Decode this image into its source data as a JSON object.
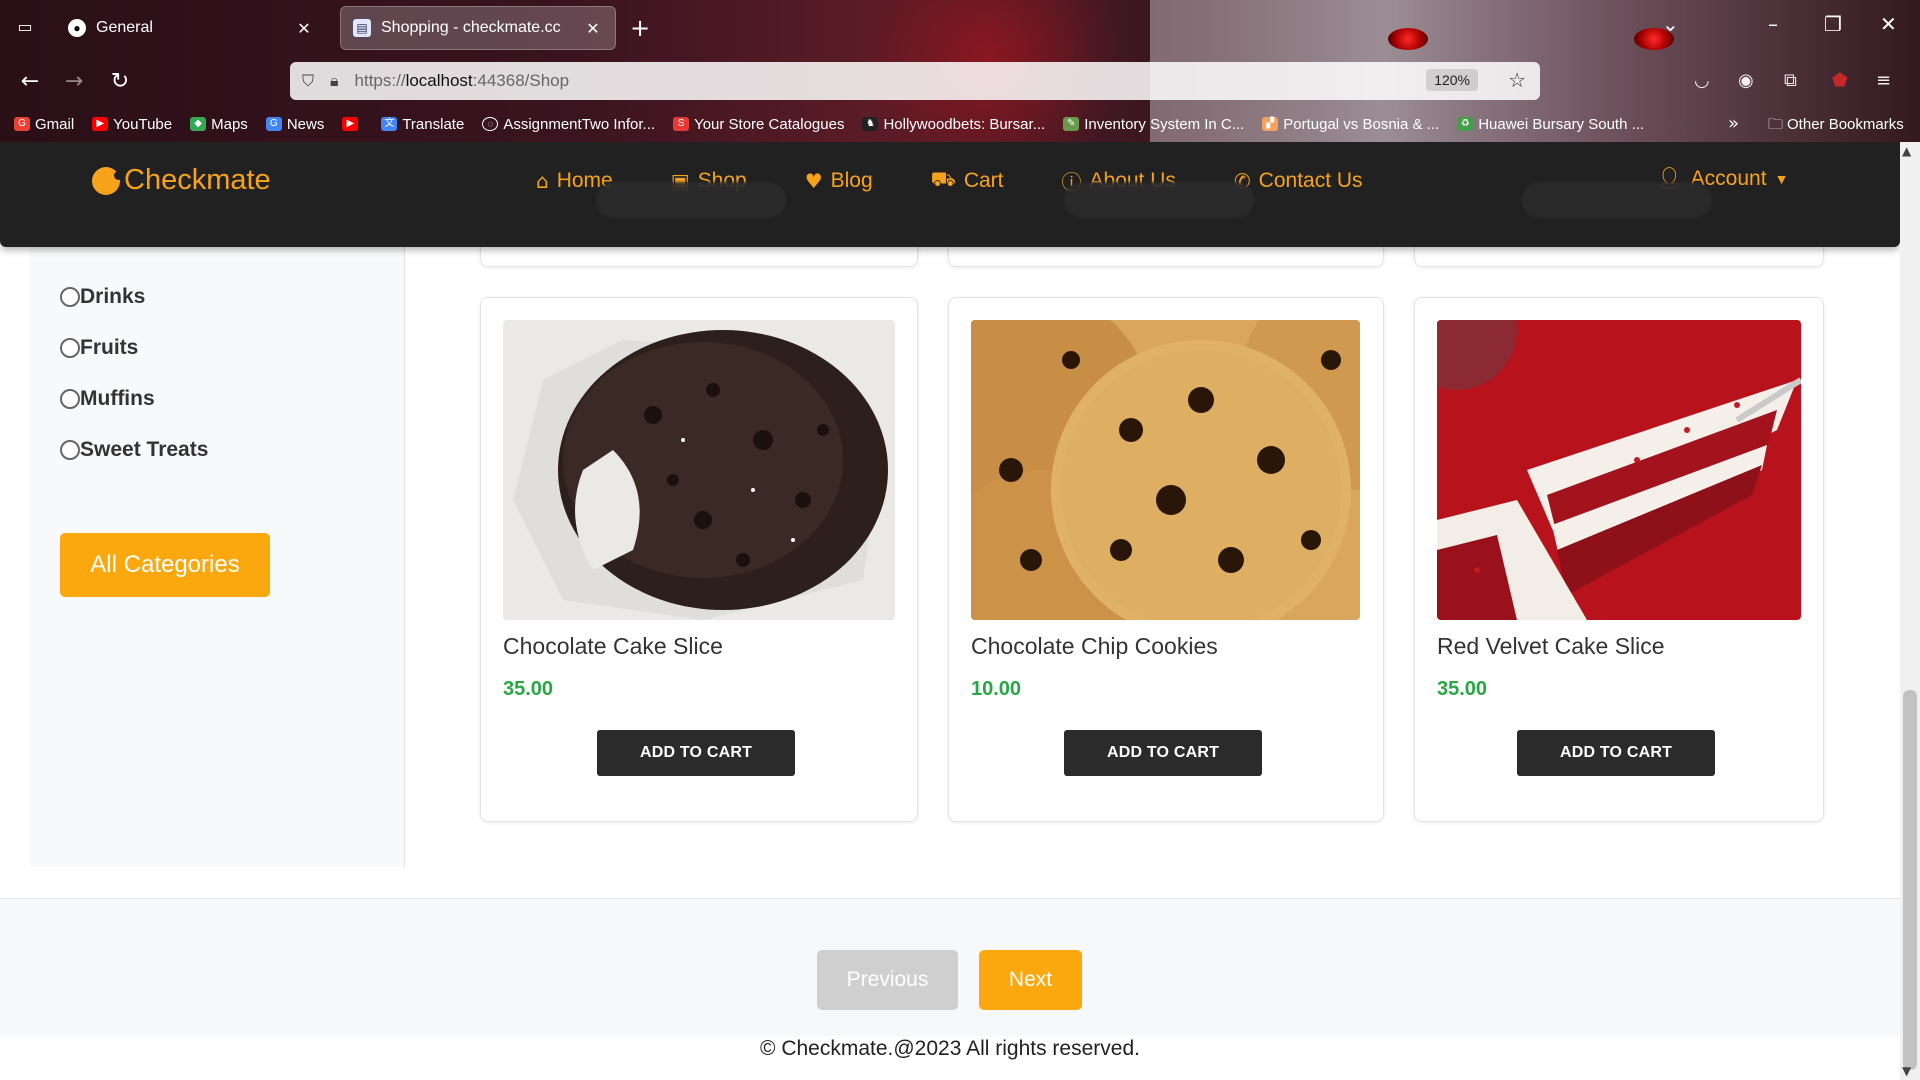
{
  "browser": {
    "tabs": [
      {
        "title": "General",
        "icon": "github-icon"
      },
      {
        "title": "Shopping - checkmate.cc",
        "icon": "page-icon"
      }
    ],
    "url": {
      "scheme": "https://",
      "host": "localhost",
      "rest": ":44368/Shop"
    },
    "zoom": "120%",
    "bookmarks": [
      {
        "label": "Gmail",
        "color": "#ea4335"
      },
      {
        "label": "YouTube",
        "color": "#ff0000"
      },
      {
        "label": "Maps",
        "color": "#34a853"
      },
      {
        "label": "News",
        "color": "#4285f4"
      },
      {
        "label": "",
        "color": "#ff0000"
      },
      {
        "label": "Translate",
        "color": "#4285f4"
      },
      {
        "label": "AssignmentTwo Infor...",
        "color": "#888888"
      },
      {
        "label": "Your Store Catalogues",
        "color": "#e53935"
      },
      {
        "label": "Hollywoodbets: Bursar...",
        "color": "#222222"
      },
      {
        "label": "Inventory System In C...",
        "color": "#6a994e"
      },
      {
        "label": "Portugal vs Bosnia & ...",
        "color": "#f4a261"
      },
      {
        "label": "Huawei Bursary South ...",
        "color": "#43a047"
      }
    ],
    "other_bookmarks": "Other Bookmarks"
  },
  "site": {
    "brand": "Checkmate",
    "menu": [
      {
        "label": "Home",
        "icon": "home-icon",
        "glyph": "⌂"
      },
      {
        "label": "Shop",
        "icon": "bag-icon",
        "glyph": "▣"
      },
      {
        "label": "Blog",
        "icon": "heart-icon",
        "glyph": "♥"
      },
      {
        "label": "Cart",
        "icon": "cart-icon",
        "glyph": "⛟"
      },
      {
        "label": "About Us",
        "icon": "info-icon",
        "glyph": "ⓘ"
      },
      {
        "label": "Contact Us",
        "icon": "phone-icon",
        "glyph": "✆"
      }
    ],
    "account": "Account",
    "accent": "#fba80f"
  },
  "sidebar": {
    "categories": [
      "Drinks",
      "Fruits",
      "Muffins",
      "Sweet Treats"
    ],
    "all_button": "All Categories"
  },
  "products": [
    {
      "name": "Chocolate Cake Slice",
      "price": "35.00",
      "button": "ADD TO CART"
    },
    {
      "name": "Chocolate Chip Cookies",
      "price": "10.00",
      "button": "ADD TO CART"
    },
    {
      "name": "Red Velvet Cake Slice",
      "price": "35.00",
      "button": "ADD TO CART"
    }
  ],
  "pagination": {
    "previous": "Previous",
    "next": "Next"
  },
  "footer": "© Checkmate.@2023 All rights reserved."
}
